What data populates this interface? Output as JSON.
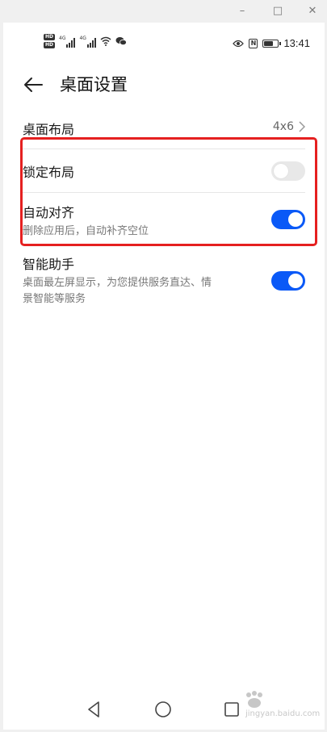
{
  "window": {
    "minimize": "–",
    "maximize": "□",
    "close": "✕"
  },
  "status_bar": {
    "net1": "4G",
    "net2": "4G",
    "hd": "HD",
    "nfc": "N",
    "time": "13:41",
    "battery_level": 0.8
  },
  "header": {
    "title": "桌面设置"
  },
  "settings": {
    "layout": {
      "title": "桌面布局",
      "value": "4x6"
    },
    "lock_layout": {
      "title": "锁定布局",
      "enabled": false
    },
    "auto_align": {
      "title": "自动对齐",
      "subtitle": "删除应用后，自动补齐空位",
      "enabled": true
    },
    "smart_assistant": {
      "title": "智能助手",
      "subtitle_line1": "桌面最左屏显示，为您提供服务直达、情",
      "subtitle_line2": "景智能等服务",
      "enabled": true
    }
  },
  "watermark": {
    "text": "jingyan.baidu.com"
  },
  "colors": {
    "accent": "#0a59f7",
    "highlight": "#e52020"
  }
}
